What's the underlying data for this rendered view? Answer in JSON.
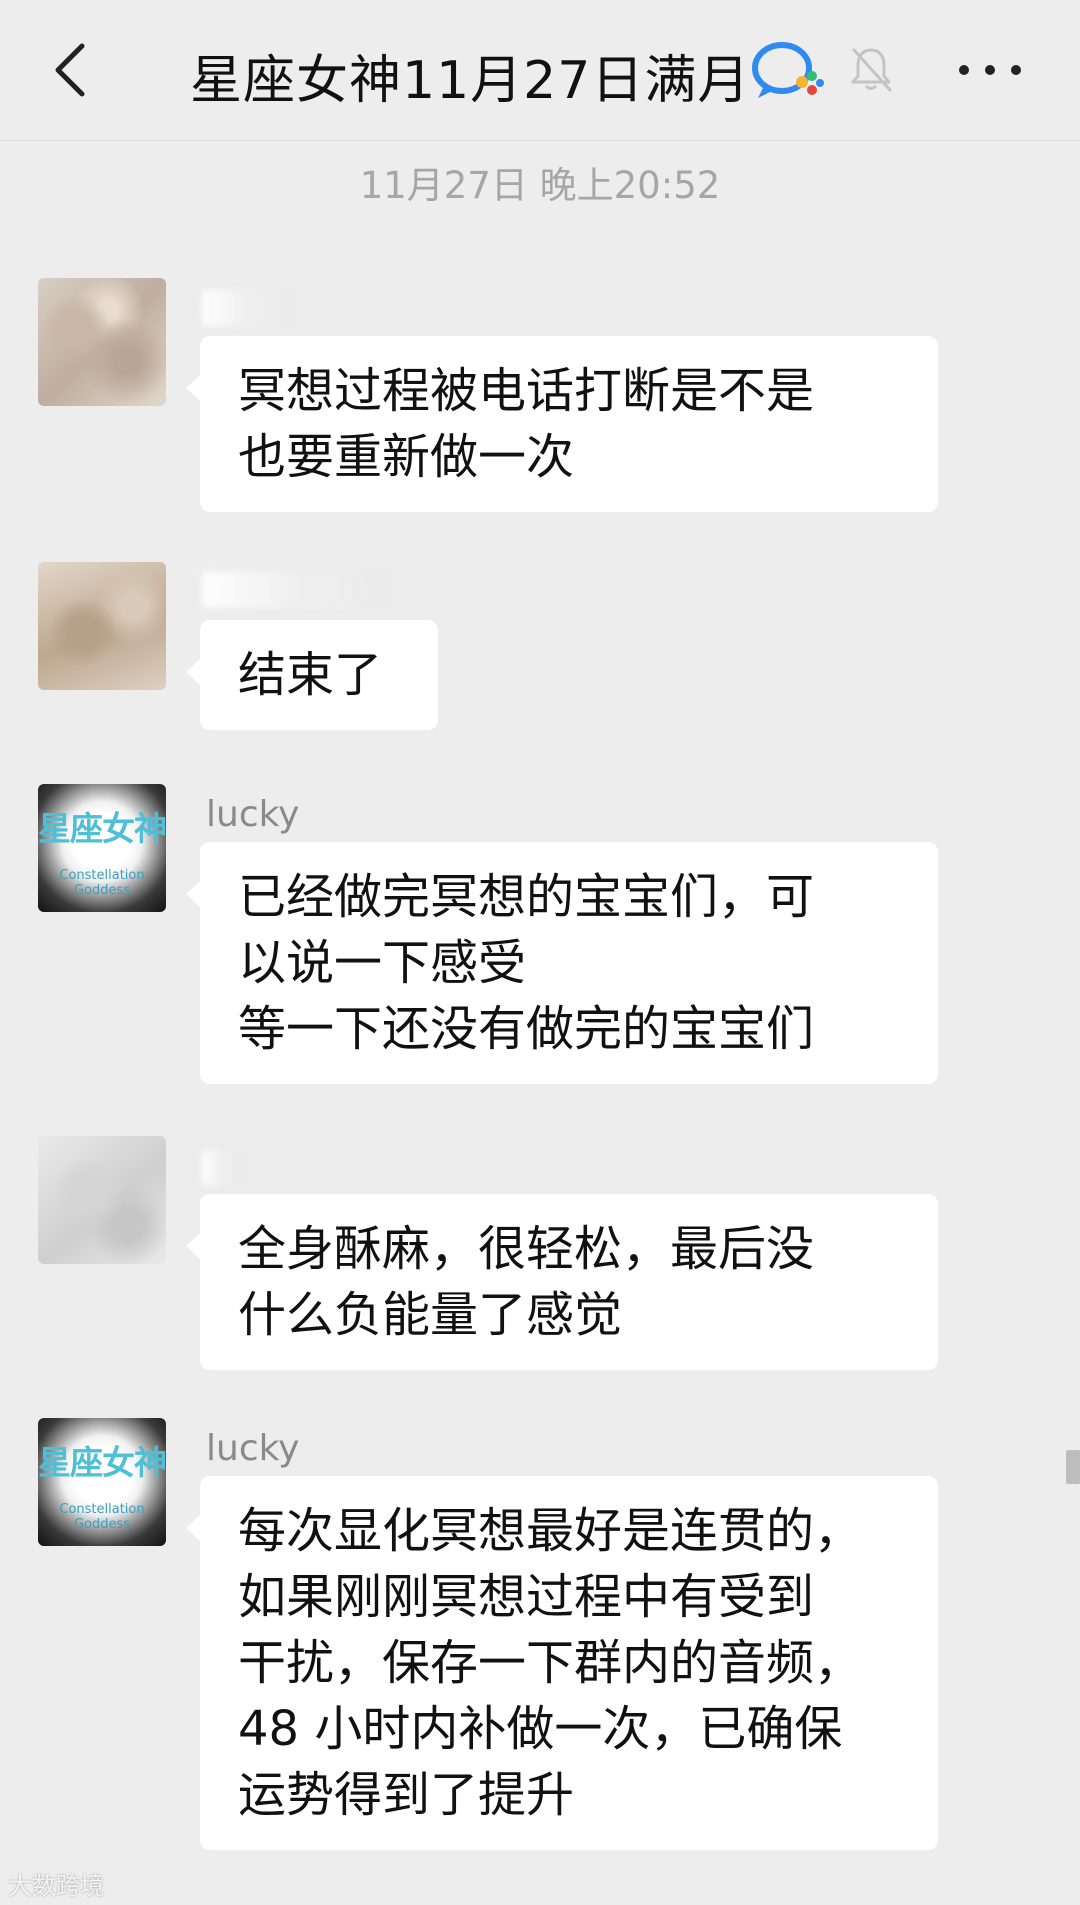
{
  "header": {
    "title": "星座女神11月27日满月",
    "back_icon": "chevron-left-icon",
    "wecom_icon": "wecom-icon",
    "mute_icon": "bell-muted-icon",
    "more_icon": "more-horizontal-icon"
  },
  "timestamp": "11月27日 晚上20:52",
  "logo": {
    "cn": "星座女神",
    "en_line1": "Constellation",
    "en_line2": "Goddess"
  },
  "messages": [
    {
      "sender": "",
      "lines": [
        "冥想过程被电话打断是不是",
        "也要重新做一次"
      ]
    },
    {
      "sender": "",
      "lines": [
        "结束了"
      ]
    },
    {
      "sender": "lucky",
      "lines": [
        "已经做完冥想的宝宝们，可",
        "以说一下感受",
        "等一下还没有做完的宝宝们"
      ]
    },
    {
      "sender": "",
      "lines": [
        "全身酥麻，很轻松，最后没",
        "什么负能量了感觉"
      ]
    },
    {
      "sender": "lucky",
      "lines": [
        "每次显化冥想最好是连贯的，",
        "如果刚刚冥想过程中有受到",
        "干扰，保存一下群内的音频，",
        "48 小时内补做一次，已确保",
        "运势得到了提升"
      ]
    }
  ],
  "watermark": "大数跨境",
  "colors": {
    "background": "#ededed",
    "bubble": "#ffffff",
    "timestamp": "#a6a6a6",
    "logo_accent": "#4dbfd6"
  }
}
